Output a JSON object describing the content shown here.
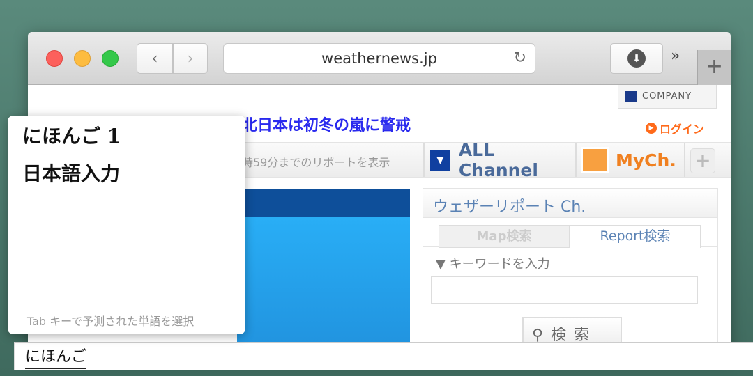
{
  "browser": {
    "url": "weathernews.jp",
    "more": "»",
    "new_tab": "+"
  },
  "page": {
    "company": "COMPANY",
    "login": "ログイン",
    "headline": "北日本は初冬の嵐に警戒",
    "report_range": "時59分までのリポートを表示",
    "all_channel": "ALL Channel",
    "mych": "MyCh.",
    "add": "+",
    "panel": {
      "title": "ウェザーリポート Ch.",
      "tabs": [
        "Map検索",
        "Report検索"
      ],
      "keyword_label": "▼ キーワードを入力",
      "keyword_value": "",
      "search_button": "検 索"
    }
  },
  "ime": {
    "candidates": [
      "にほんご 1",
      "日本語入力"
    ],
    "hint": "Tab キーで予測された単語を選択",
    "composition": "にほんご"
  },
  "colors": {
    "headline": "#2a2aee",
    "login": "#ff6a1a",
    "mych": "#f08020",
    "channel": "#4a6a9a"
  }
}
